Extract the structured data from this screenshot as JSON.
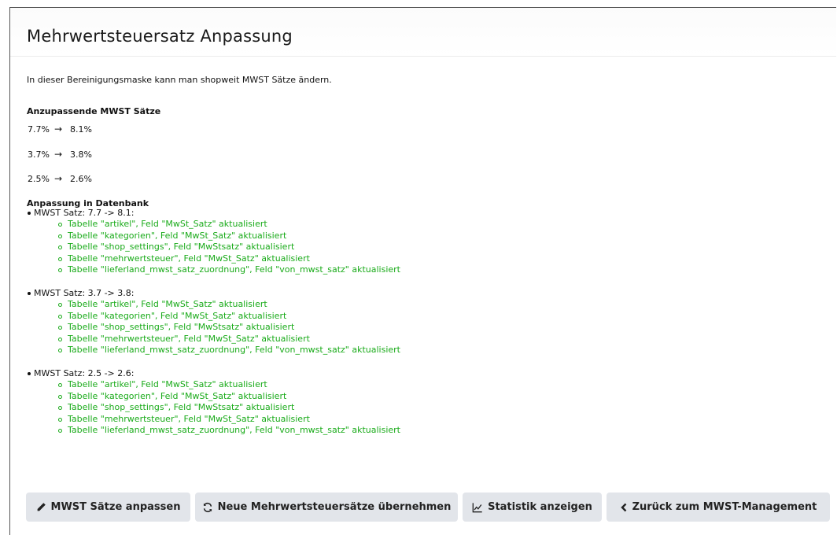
{
  "page": {
    "title": "Mehrwertsteuersatz Anpassung"
  },
  "intro": "In dieser Bereinigungsmaske kann man shopweit MWST Sätze ändern.",
  "rates": {
    "heading": "Anzupassende MWST Sätze",
    "arrow": "→",
    "items": [
      {
        "from": "7.7%",
        "to": "8.1%"
      },
      {
        "from": "3.7%",
        "to": "3.8%"
      },
      {
        "from": "2.5%",
        "to": "2.6%"
      }
    ]
  },
  "database": {
    "heading": "Anpassung in Datenbank",
    "groups": [
      {
        "label": "MWST Satz: 7.7 -> 8.1:",
        "items": [
          "Tabelle \"artikel\", Feld \"MwSt_Satz\" aktualisiert",
          "Tabelle \"kategorien\", Feld \"MwSt_Satz\" aktualisiert",
          "Tabelle \"shop_settings\", Feld \"MwStsatz\" aktualisiert",
          "Tabelle \"mehrwertsteuer\", Feld \"MwSt_Satz\" aktualisiert",
          "Tabelle \"lieferland_mwst_satz_zuordnung\", Feld \"von_mwst_satz\" aktualisiert"
        ]
      },
      {
        "label": "MWST Satz: 3.7 -> 3.8:",
        "items": [
          "Tabelle \"artikel\", Feld \"MwSt_Satz\" aktualisiert",
          "Tabelle \"kategorien\", Feld \"MwSt_Satz\" aktualisiert",
          "Tabelle \"shop_settings\", Feld \"MwStsatz\" aktualisiert",
          "Tabelle \"mehrwertsteuer\", Feld \"MwSt_Satz\" aktualisiert",
          "Tabelle \"lieferland_mwst_satz_zuordnung\", Feld \"von_mwst_satz\" aktualisiert"
        ]
      },
      {
        "label": "MWST Satz: 2.5 -> 2.6:",
        "items": [
          "Tabelle \"artikel\", Feld \"MwSt_Satz\" aktualisiert",
          "Tabelle \"kategorien\", Feld \"MwSt_Satz\" aktualisiert",
          "Tabelle \"shop_settings\", Feld \"MwStsatz\" aktualisiert",
          "Tabelle \"mehrwertsteuer\", Feld \"MwSt_Satz\" aktualisiert",
          "Tabelle \"lieferland_mwst_satz_zuordnung\", Feld \"von_mwst_satz\" aktualisiert"
        ]
      }
    ]
  },
  "buttons": {
    "adjust": {
      "label": "MWST Sätze anpassen",
      "icon": "pencil-icon"
    },
    "apply": {
      "label": "Neue Mehrwertsteuersätze übernehmen",
      "icon": "refresh-icon"
    },
    "stats": {
      "label": "Statistik anzeigen",
      "icon": "line-chart-icon"
    },
    "back": {
      "label": "Zurück zum MWST-Management",
      "icon": "chevron-left-icon"
    }
  },
  "colors": {
    "success": "#1aab1a",
    "button_bg": "#e2e5ea"
  }
}
